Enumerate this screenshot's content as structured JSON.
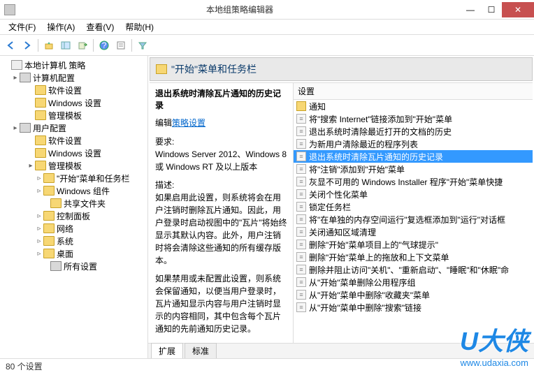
{
  "window": {
    "title": "本地组策略编辑器"
  },
  "menus": {
    "file": "文件(F)",
    "action": "操作(A)",
    "view": "查看(V)",
    "help": "帮助(H)"
  },
  "tree": {
    "root": "本地计算机 策略",
    "computer": "计算机配置",
    "user": "用户配置",
    "software": "软件设置",
    "windows": "Windows 设置",
    "admin": "管理模板",
    "startmenu": "\"开始\"菜单和任务栏",
    "wincomp": "Windows 组件",
    "shared": "共享文件夹",
    "control": "控制面板",
    "network": "网络",
    "system": "系统",
    "desktop": "桌面",
    "allsettings": "所有设置"
  },
  "header": {
    "title": "\"开始\"菜单和任务栏"
  },
  "desc": {
    "settingName": "退出系统时清除瓦片通知的历史记录",
    "editLabel": "编辑",
    "policyLink": "策略设置",
    "reqLabel": "要求:",
    "reqText": "Windows Server 2012、Windows 8 或 Windows RT 及以上版本",
    "descLabel": "描述:",
    "p1": "如果启用此设置，则系统将会在用户注销时删除瓦片通知。因此，用户登录时启动视图中的\"瓦片\"将始终显示其默认内容。此外，用户注销时将会清除这些通知的所有缓存版本。",
    "p2": "如果禁用或未配置此设置，则系统会保留通知，以便当用户登录时，瓦片通知显示内容与用户注销时显示的内容相同，其中包含每个瓦片通知的先前通知历史记录。"
  },
  "listHeader": "设置",
  "settings": {
    "folder0": "通知",
    "s1": "将\"搜索 Internet\"链接添加到\"开始\"菜单",
    "s2": "退出系统时清除最近打开的文档的历史",
    "s3": "为新用户清除最近的程序列表",
    "s4": "退出系统时清除瓦片通知的历史记录",
    "s5": "将\"注销\"添加到\"开始\"菜单",
    "s6": "灰显不可用的 Windows Installer 程序\"开始\"菜单快捷",
    "s7": "关闭个性化菜单",
    "s8": "锁定任务栏",
    "s9": "将\"在单独的内存空间运行\"复选框添加到\"运行\"对话框",
    "s10": "关闭通知区域清理",
    "s11": "删除\"开始\"菜单项目上的\"气球提示\"",
    "s12": "删除\"开始\"菜单上的拖放和上下文菜单",
    "s13": "删除并阻止访问\"关机\"、\"重新启动\"、\"睡眠\"和\"休眠\"命",
    "s14": "从\"开始\"菜单删除公用程序组",
    "s15": "从\"开始\"菜单中删除\"收藏夹\"菜单",
    "s16": "从\"开始\"菜单中删除\"搜索\"链接"
  },
  "tabs": {
    "extended": "扩展",
    "standard": "标准"
  },
  "status": {
    "count": "80 个设置"
  },
  "watermark": {
    "brand": "U大侠",
    "url": "www.udaxia.com"
  }
}
